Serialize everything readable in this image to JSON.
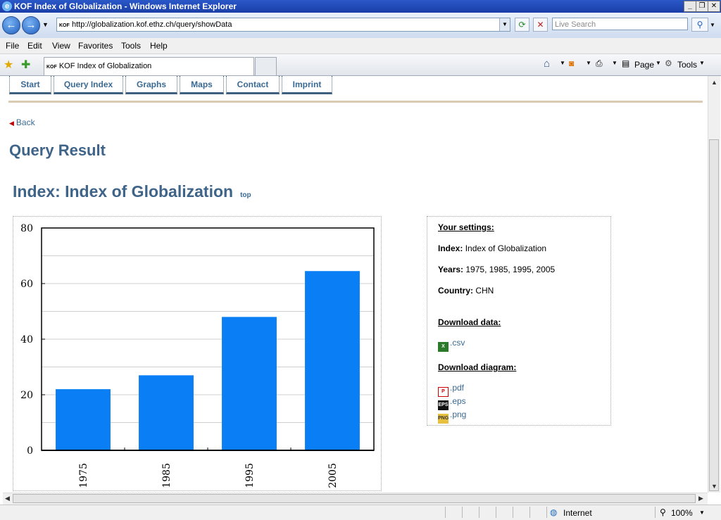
{
  "window": {
    "title": "KOF Index of Globalization - Windows Internet Explorer"
  },
  "address_bar": {
    "url": "http://globalization.kof.ethz.ch/query/showData",
    "search_placeholder": "Live Search"
  },
  "menu": [
    "File",
    "Edit",
    "View",
    "Favorites",
    "Tools",
    "Help"
  ],
  "tab": {
    "title": "KOF Index of Globalization"
  },
  "command_bar": {
    "page_label": "Page",
    "tools_label": "Tools"
  },
  "site_nav": [
    "Start",
    "Query Index",
    "Graphs",
    "Maps",
    "Contact",
    "Imprint"
  ],
  "back_label": "Back",
  "page_title": "Query Result",
  "index_heading": "Index: Index of Globalization",
  "top_link": "top",
  "settings": {
    "heading": "Your settings:",
    "index_label": "Index:",
    "index_value": "Index of Globalization",
    "years_label": "Years:",
    "years_value": "1975, 1985, 1995, 2005",
    "country_label": "Country:",
    "country_value": "CHN",
    "download_data_heading": "Download data:",
    "csv_label": ".csv",
    "download_diagram_heading": "Download diagram:",
    "pdf_label": ".pdf",
    "eps_label": ".eps",
    "png_label": ".png"
  },
  "status_bar": {
    "zone": "Internet",
    "zoom": "100%"
  },
  "chart_data": {
    "type": "bar",
    "categories": [
      "1975",
      "1985",
      "1995",
      "2005"
    ],
    "values": [
      22,
      27,
      48,
      64.5
    ],
    "ylim": [
      0,
      80
    ],
    "yticks": [
      "0",
      "20",
      "40",
      "60",
      "80"
    ],
    "grid": true,
    "bar_color": "#0a7ff5"
  }
}
